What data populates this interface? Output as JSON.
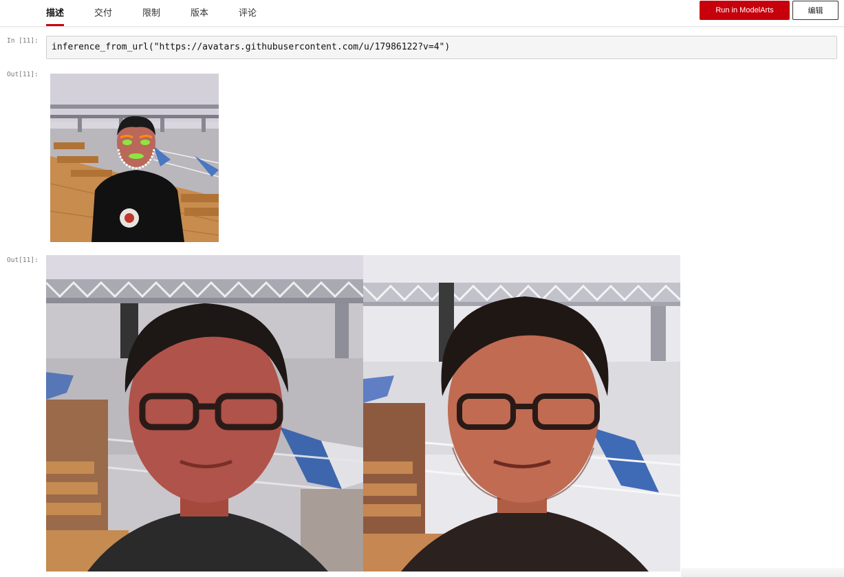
{
  "tabs": [
    {
      "label": "描述",
      "active": true
    },
    {
      "label": "交付",
      "active": false
    },
    {
      "label": "限制",
      "active": false
    },
    {
      "label": "版本",
      "active": false
    },
    {
      "label": "评论",
      "active": false
    }
  ],
  "toolbar": {
    "run_label": "Run in ModelArts",
    "edit_label": "编辑"
  },
  "cell": {
    "in_prompt": "In [11]:",
    "code": "inference_from_url(\"https://avatars.githubusercontent.com/u/17986122?v=4\")",
    "out_prompt_1": "Out[11]:",
    "out_prompt_2": "Out[11]:"
  },
  "colors": {
    "accent": "#c7000b",
    "input_bg": "#f5f5f5",
    "prompt_text": "#777777"
  },
  "icons": {
    "output_image_1": "photo-face-landmarks",
    "output_image_2": "photo-original",
    "output_image_3": "photo-painted-style"
  }
}
